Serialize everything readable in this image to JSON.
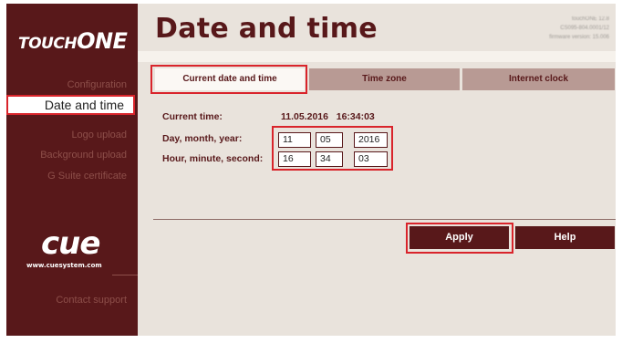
{
  "brand": {
    "logo_part1": "TOUCH",
    "logo_part2": "ONE",
    "partner_logo": "cue",
    "partner_url": "www.cuesystem.com"
  },
  "sidebar": {
    "items": [
      {
        "label": "Configuration"
      },
      {
        "label": "Date and time",
        "active": true
      },
      {
        "label": "Logo upload"
      },
      {
        "label": "Background upload"
      },
      {
        "label": "G Suite certificate"
      },
      {
        "label": "Contact support"
      }
    ]
  },
  "header": {
    "title": "Date and time",
    "version_lines": [
      "touchONE 12.8",
      "CS095-804.0001/12",
      "firmware version: 15.006"
    ]
  },
  "tabs": [
    {
      "label": "Current date and time",
      "active": true
    },
    {
      "label": "Time zone"
    },
    {
      "label": "Internet clock"
    }
  ],
  "form": {
    "current_time_label": "Current time:",
    "current_time_value": "11.05.2016   16:34:03",
    "date_label": "Day, month, year:",
    "time_label": "Hour, minute, second:",
    "day": "11",
    "month": "05",
    "year": "2016",
    "hour": "16",
    "minute": "34",
    "second": "03"
  },
  "actions": {
    "apply": "Apply",
    "help": "Help"
  },
  "colors": {
    "accent": "#58181a",
    "tab_inactive": "#b89a94",
    "highlight": "#d9242b",
    "background": "#e9e3dc"
  }
}
